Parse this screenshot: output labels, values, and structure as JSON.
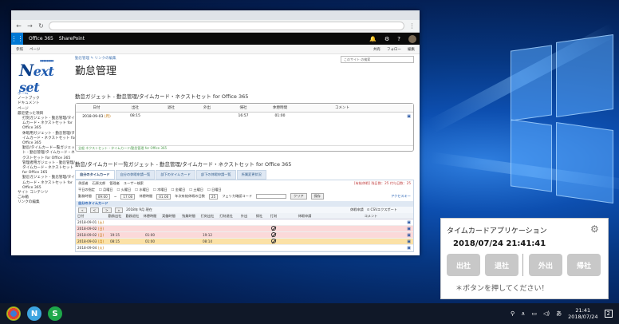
{
  "browser": {
    "o365": {
      "app": "Office 365",
      "site": "SharePoint"
    },
    "ribbon": {
      "tab1": "参照",
      "tab2": "ページ",
      "share": "共有",
      "follow": "フォロー",
      "edit": "編集"
    },
    "header": {
      "breadcrumb": "勤怠管理",
      "edit_links": "リンクの編集",
      "title": "勤怠管理",
      "search_placeholder": "このサイト の検索",
      "logo_text": "ext set",
      "logo_N": "N"
    },
    "leftnav": [
      {
        "label": "ホーム",
        "selected": true
      },
      {
        "label": "ノートブック"
      },
      {
        "label": "ドキュメント"
      },
      {
        "label": "ページ"
      },
      {
        "label": "最近使った項目"
      },
      {
        "label": "打刻ガジェット - 勤怠管理/タイムカード・ネクストセット for Office 365",
        "sub": true
      },
      {
        "label": "休暇用ガジェット - 勤怠管理/タイムカード・ネクストセット for Office 365",
        "sub": true
      },
      {
        "label": "勤怠/タイムカード一覧ガジェット - 勤怠管理/タイムカード・ネクストセット for Office 365",
        "sub": true
      },
      {
        "label": "管理者用ガジェット - 勤怠管理/タイムカード・ネクストセット for Office 365",
        "sub": true
      },
      {
        "label": "勤怠ガジェット - 勤怠管理/タイムカード・ネクストセット for Office 365",
        "sub": true
      },
      {
        "label": "サイト コンテンツ"
      },
      {
        "label": "ごみ箱"
      },
      {
        "label": "リンクの編集"
      }
    ],
    "kintai": {
      "title": "勤怠ガジェット - 勤怠管理/タイムカード・ネクストセット for Office 365",
      "cols": [
        "日付",
        "出社",
        "退社",
        "外出",
        "帰社",
        "休憩時間",
        "コメント"
      ],
      "row": {
        "date": "2018-09-03",
        "day": "(月)",
        "in": "08:15",
        "out": "",
        "away": "",
        "back": "16:57",
        "break": "01:00",
        "comment": ""
      },
      "footer": "全般 ネクストセット・タイムカード/勤怠管理 for Office 365"
    },
    "list": {
      "title": "勤怠/タイムカード一覧ガジェット - 勤怠管理/タイムカード・ネクストセット for Office 365",
      "tabs": [
        "自分のタイムカード",
        "自分の休暇申請一覧",
        "部下のタイムカード",
        "部下の休暇申請一覧",
        "所属変更状況"
      ],
      "paid_leave": "[有給休暇] 残日数：25 付与日数：25",
      "row1": {
        "label": "承認者",
        "a": "石原太郎",
        "b": "管理者",
        "c": "ユーザー検索"
      },
      "row2": {
        "label": "平日の指定",
        "days": [
          "月曜日",
          "火曜日",
          "水曜日",
          "木曜日",
          "金曜日",
          "土曜日",
          "日曜日"
        ]
      },
      "row3": {
        "label": "勤務時間",
        "from": "09:00",
        "to": "17:00",
        "break_label": "休憩時間",
        "break": "01:00",
        "annual_label": "年次有給休暇の日数",
        "annual": "25",
        "code_label": "フェリカ確認コード",
        "clear": "クリア",
        "save": "保存",
        "access": "アクセスキー"
      },
      "grid_title": "自分のタイムカード",
      "month": "2018年 9月 現在",
      "leave_req": "休暇申請",
      "csv": "CSVエクスポート",
      "grid_cols": [
        "日付",
        "勤務出社",
        "勤務退社",
        "休憩時間",
        "実働時間",
        "残業時間",
        "打刻出社",
        "打刻退社",
        "外出",
        "帰社",
        "打刻",
        "休暇申請",
        "コメント"
      ],
      "grid_rows": [
        {
          "date": "2018-09-01",
          "day": "(土)",
          "c2": "",
          "c3": "",
          "c4": "",
          "c5": "",
          "c6": "",
          "c7": "",
          "c8": "",
          "c9": "",
          "c10": "",
          "ban": false,
          "style": ""
        },
        {
          "date": "2018-09-02",
          "day": "(日)",
          "c2": "",
          "c3": "",
          "c4": "",
          "c5": "",
          "c6": "",
          "c7": "",
          "c8": "",
          "c9": "",
          "c10": "",
          "ban": true,
          "style": "pink"
        },
        {
          "date": "2018-09-02",
          "day": "(日)",
          "c2": "19:15",
          "c3": "",
          "c4": "01:00",
          "c5": "",
          "c6": "",
          "c7": "19:12",
          "c8": "",
          "c9": "",
          "c10": "",
          "ban": true,
          "style": "pink"
        },
        {
          "date": "2018-09-03",
          "day": "(月)",
          "c2": "08:15",
          "c3": "",
          "c4": "01:00",
          "c5": "",
          "c6": "",
          "c7": "08:14",
          "c8": "",
          "c9": "",
          "c10": "",
          "ban": true,
          "style": "yellow"
        },
        {
          "date": "2018-09-04",
          "day": "(火)",
          "c2": "",
          "c3": "",
          "c4": "",
          "c5": "",
          "c6": "",
          "c7": "",
          "c8": "",
          "c9": "",
          "c10": "",
          "ban": false,
          "style": ""
        }
      ]
    }
  },
  "tcapp": {
    "title": "タイムカードアプリケーション",
    "datetime": "2018/07/24 21:41:41",
    "btn_in": "出社",
    "btn_out": "退社",
    "btn_away": "外出",
    "btn_back": "帰社",
    "message": "＊ボタンを押してください！"
  },
  "taskbar": {
    "time": "21:41",
    "date": "2018/07/24",
    "notif_count": "2"
  },
  "colors": {
    "accent": "#0078d4",
    "o365bar": "#0a0a0a",
    "row_pink": "#fbd9d9",
    "row_yellow": "#fbe1a6",
    "button_gray": "#c8c8c8"
  }
}
